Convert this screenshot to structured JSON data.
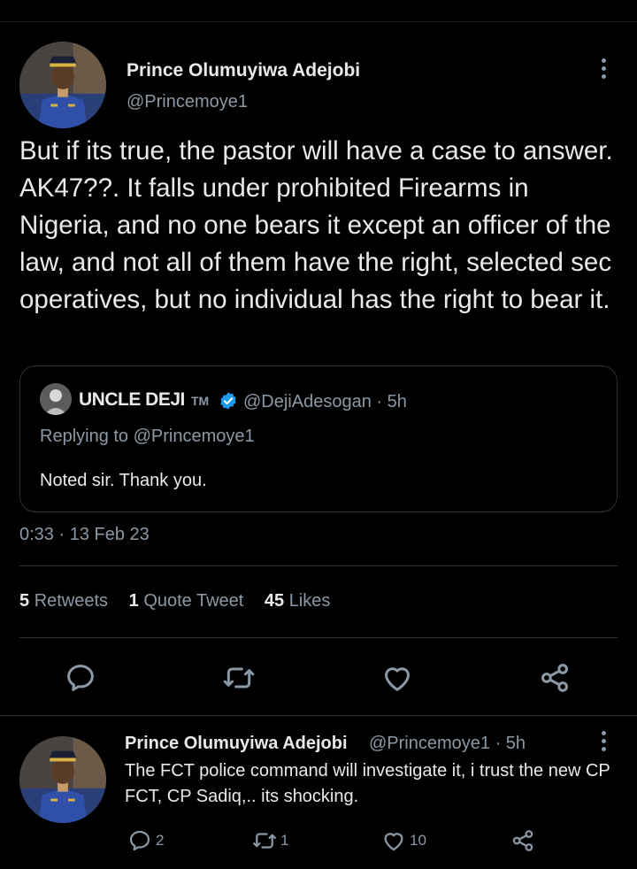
{
  "main_tweet": {
    "author_name": "Prince Olumuyiwa Adejobi",
    "author_handle": "@Princemoye1",
    "text": "But if its true, the pastor will have a case to answer. AK47??. It falls under prohibited Firearms in Nigeria, and no one bears it except an officer of the law, and not all of them have the right, selected sec operatives, but no individual has the right to bear it.",
    "timestamp": "0:33 · 13 Feb 23"
  },
  "quoted_tweet": {
    "author_name": "UNCLE DEJI",
    "tm": "TM",
    "author_handle": "@DejiAdesogan · 5h",
    "replying_to": "Replying to @Princemoye1",
    "text": "Noted sir. Thank you."
  },
  "stats": {
    "retweets_count": "5",
    "retweets_label": "Retweets",
    "quotes_count": "1",
    "quotes_label": "Quote Tweet",
    "likes_count": "45",
    "likes_label": "Likes"
  },
  "icons": {
    "reply": "reply-icon",
    "retweet": "retweet-icon",
    "like": "heart-icon",
    "share": "share-icon",
    "more": "more-vertical-icon",
    "verified": "verified-badge-icon"
  },
  "reply_tweet": {
    "author_name": "Prince Olumuyiwa Adejobi",
    "author_handle": "@Princemoye1 · 5h",
    "text": "The FCT police command will investigate it, i trust the new CP FCT, CP Sadiq,.. its shocking.",
    "reply_count": "2",
    "retweet_count": "1",
    "like_count": "10"
  },
  "colors": {
    "background": "#000000",
    "text_primary": "#e7e9ea",
    "text_secondary": "#8b98a5",
    "divider": "#2f3336",
    "verified_blue": "#1d9bf0"
  }
}
